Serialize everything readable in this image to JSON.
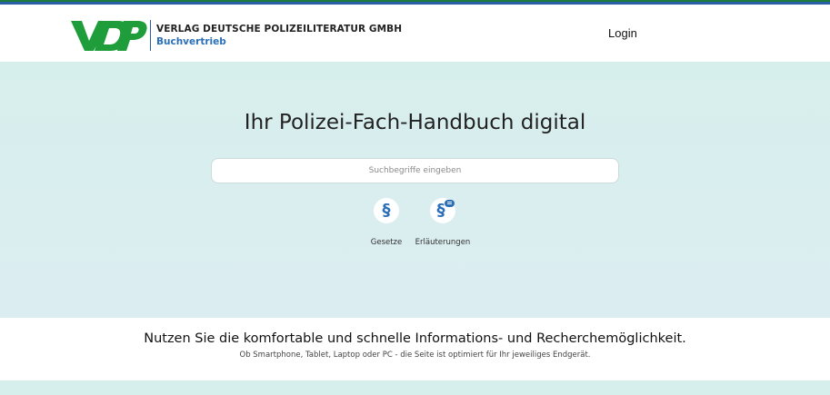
{
  "header": {
    "logo_line1": "VERLAG DEUTSCHE POLIZEILITERATUR GMBH",
    "logo_line2": "Buchvertrieb",
    "login_label": "Login"
  },
  "hero": {
    "title": "Ihr Polizei-Fach-Handbuch digital",
    "search_placeholder": "Suchbegriffe eingeben",
    "categories": [
      {
        "label": "Gesetze",
        "icon": "paragraph-icon"
      },
      {
        "label": "Erläuterungen",
        "icon": "paragraph-comment-icon"
      }
    ]
  },
  "info": {
    "title": "Nutzen Sie die komfortable und schnelle Informations- und Recherchemöglichkeit.",
    "subtitle": "Ob Smartphone, Tablet, Laptop oder PC - die Seite ist optimiert für Ihr jeweiliges Endgerät."
  },
  "colors": {
    "brand_green": "#1f9d3a",
    "brand_blue": "#2a6fb8",
    "hero_bg": "#d7efec"
  }
}
